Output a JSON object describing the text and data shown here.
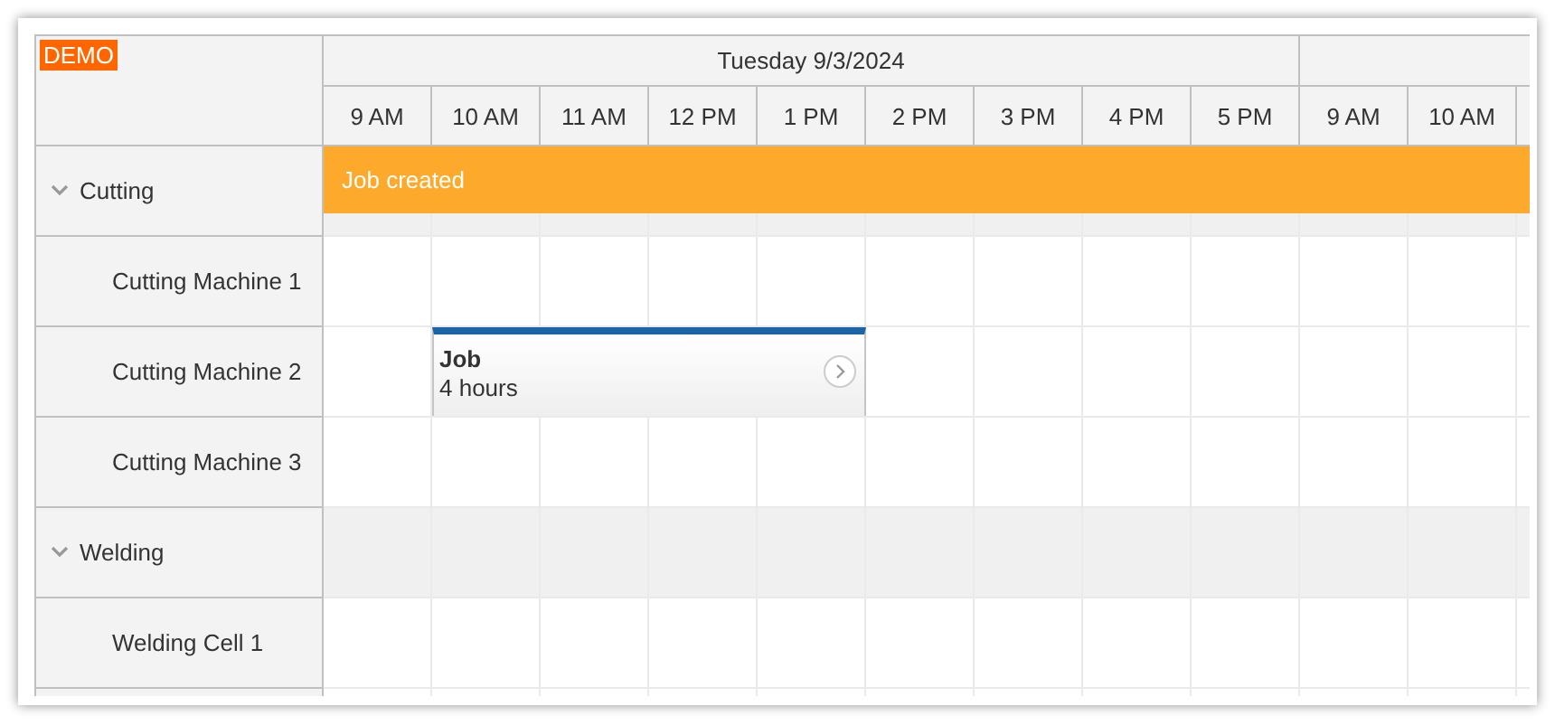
{
  "badge": "DEMO",
  "days": [
    {
      "label": "Tuesday 9/3/2024",
      "hours": [
        "9 AM",
        "10 AM",
        "11 AM",
        "12 PM",
        "1 PM",
        "2 PM",
        "3 PM",
        "4 PM",
        "5 PM"
      ]
    },
    {
      "hours": [
        "9 AM",
        "10 AM"
      ]
    }
  ],
  "groups": [
    {
      "name": "Cutting",
      "expanded": true,
      "event": {
        "text": "Job created"
      },
      "children": [
        {
          "name": "Cutting Machine 1"
        },
        {
          "name": "Cutting Machine 2",
          "events": [
            {
              "title": "Job",
              "duration": "4 hours"
            }
          ]
        },
        {
          "name": "Cutting Machine 3"
        }
      ]
    },
    {
      "name": "Welding",
      "expanded": true,
      "children": [
        {
          "name": "Welding Cell 1"
        }
      ]
    }
  ]
}
